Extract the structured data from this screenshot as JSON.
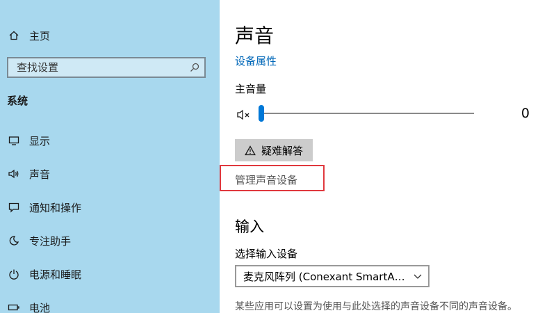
{
  "sidebar": {
    "home": "主页",
    "search": {
      "placeholder": "查找设置"
    },
    "section": "系统",
    "items": [
      {
        "id": "display",
        "label": "显示",
        "icon": "monitor-icon"
      },
      {
        "id": "sound",
        "label": "声音",
        "icon": "speaker-icon"
      },
      {
        "id": "notifications",
        "label": "通知和操作",
        "icon": "message-icon"
      },
      {
        "id": "focus",
        "label": "专注助手",
        "icon": "moon-icon"
      },
      {
        "id": "power",
        "label": "电源和睡眠",
        "icon": "power-icon"
      },
      {
        "id": "battery",
        "label": "电池",
        "icon": "battery-icon"
      }
    ]
  },
  "main": {
    "title": "声音",
    "device_properties": "设备属性",
    "master_volume": {
      "label": "主音量",
      "value": 0,
      "max": 100,
      "value_text": "0"
    },
    "troubleshoot_label": "疑难解答",
    "manage_devices": "管理声音设备",
    "input": {
      "title": "输入",
      "device_label": "选择输入设备",
      "device_value": "麦克风阵列 (Conexant SmartAudi...",
      "note": "某些应用可以设置为使用与此处选择的声音设备不同的声音设备。"
    }
  },
  "colors": {
    "sidebar_bg": "#a8d8ee",
    "accent": "#0078d7",
    "link": "#0067b8",
    "highlight": "#e0383e"
  }
}
